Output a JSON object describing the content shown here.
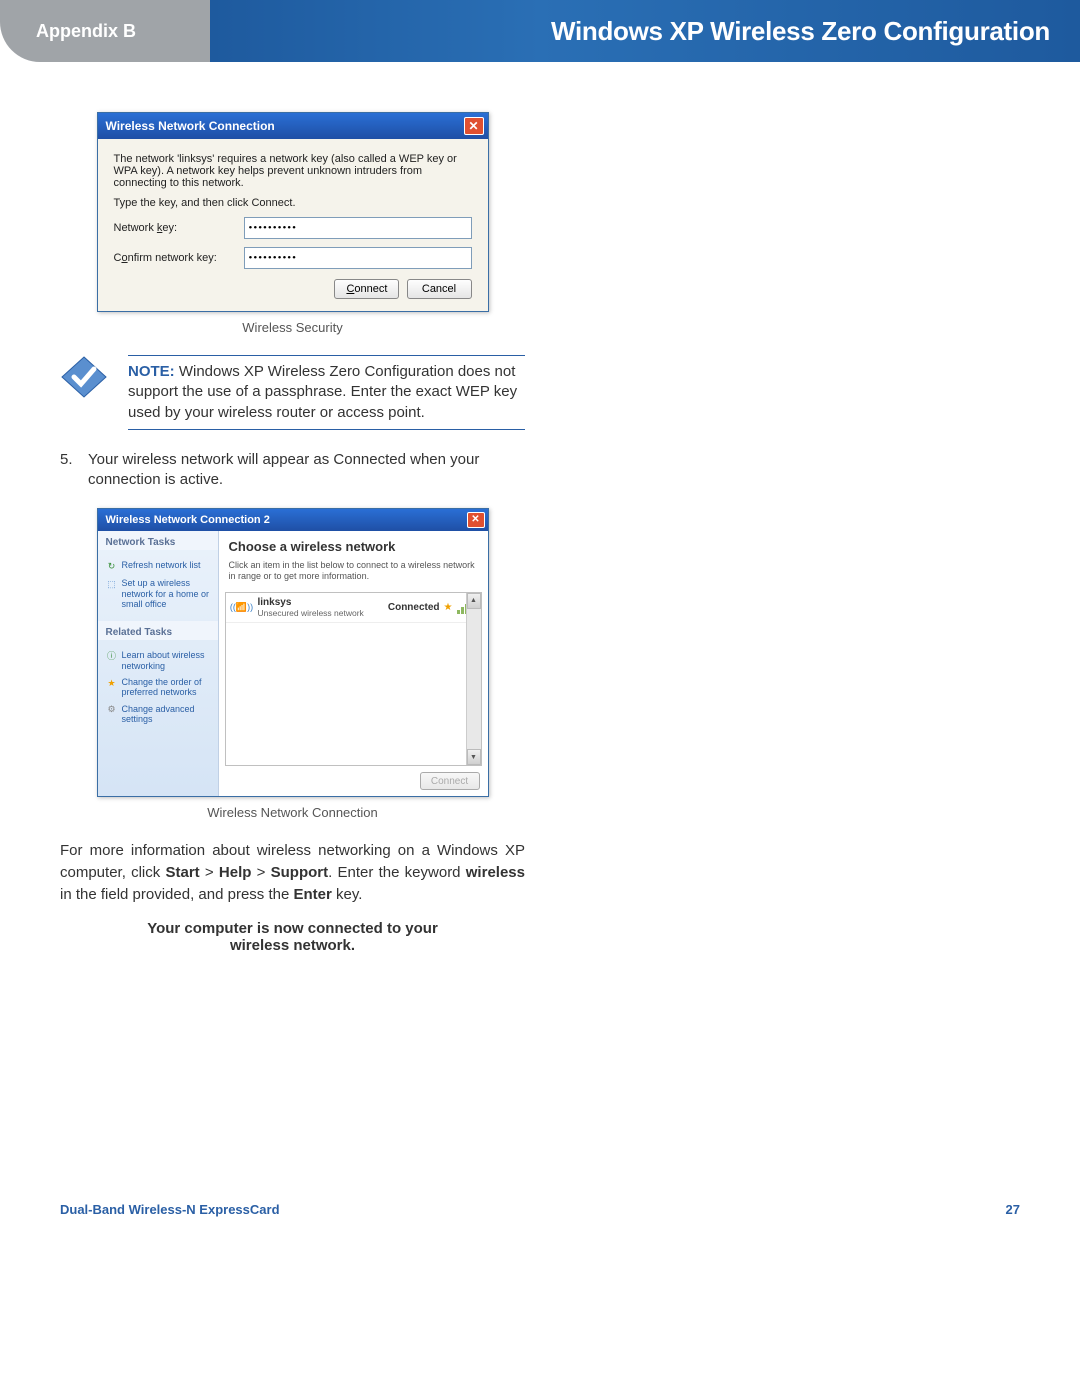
{
  "header": {
    "left": "Appendix B",
    "right": "Windows XP Wireless Zero Configuration"
  },
  "dialog1": {
    "title": "Wireless Network Connection",
    "intro": "The network 'linksys' requires a network key (also called a WEP key or WPA key). A network key helps prevent unknown intruders from connecting to this network.",
    "typeline": "Type the key, and then click Connect.",
    "label_key": "Network key:",
    "label_key_u": "k",
    "value_key": "••••••••••",
    "label_confirm": "Confirm network key:",
    "label_confirm_u": "o",
    "value_confirm": "••••••••••",
    "btn_connect": "Connect",
    "btn_connect_u": "C",
    "btn_cancel": "Cancel",
    "caption": "Wireless Security"
  },
  "note": {
    "label": "NOTE:",
    "text": "Windows XP Wireless Zero Configuration does not support the use of a passphrase. Enter the exact WEP key used by your wireless router or access point."
  },
  "step5": {
    "num": "5.",
    "text": "Your wireless network will appear as Connected when your connection is active."
  },
  "wnc": {
    "title": "Wireless Network Connection 2",
    "side": {
      "hdr1": "Network Tasks",
      "link_refresh": "Refresh network list",
      "link_setup": "Set up a wireless network for a home or small office",
      "hdr2": "Related Tasks",
      "link_learn": "Learn about wireless networking",
      "link_order": "Change the order of preferred networks",
      "link_adv": "Change advanced settings"
    },
    "choose_hdr": "Choose a wireless network",
    "instr": "Click an item in the list below to connect to a wireless network in range or to get more information.",
    "net_name": "linksys",
    "net_type": "Unsecured wireless network",
    "status": "Connected",
    "btn_connect": "Connect",
    "caption": "Wireless Network Connection"
  },
  "para": {
    "p1_a": "For more information about wireless networking on a Windows XP computer, click ",
    "start": "Start",
    "gt1": " > ",
    "help": "Help",
    "gt2": " > ",
    "support": "Support",
    "p1_b": ". Enter the keyword ",
    "wireless": "wireless",
    "p1_c": " in the field provided, and press the ",
    "enter": "Enter",
    "p1_d": " key."
  },
  "connected_msg_a": "Your computer is now connected to your",
  "connected_msg_b": "wireless network.",
  "footer": {
    "left": "Dual-Band Wireless-N ExpressCard",
    "right": "27"
  }
}
